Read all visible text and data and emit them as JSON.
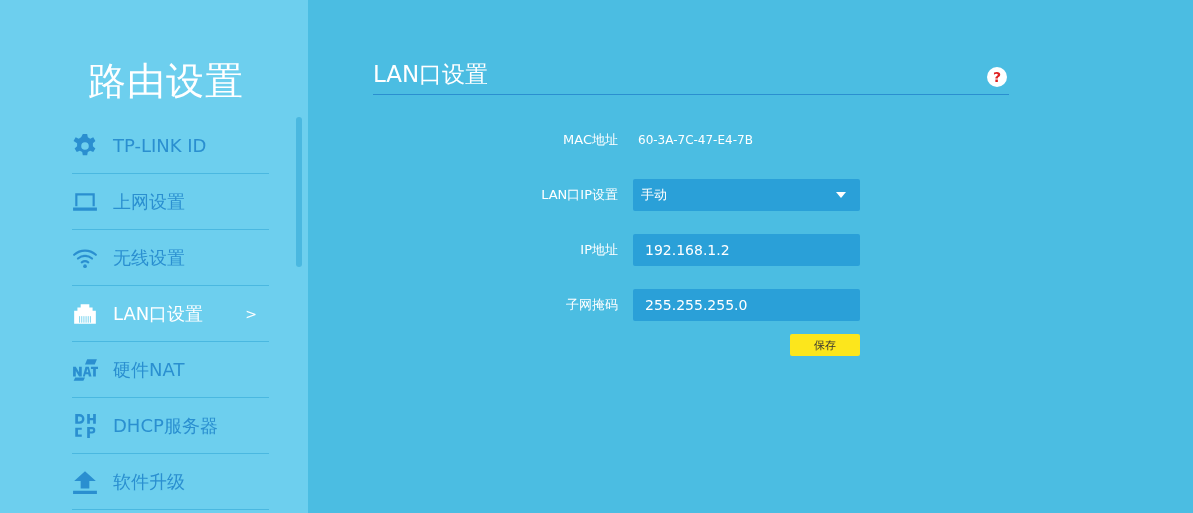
{
  "sidebar": {
    "title": "路由设置",
    "items": [
      {
        "label": "TP-LINK ID",
        "kind": "gear",
        "selected": false
      },
      {
        "label": "上网设置",
        "kind": "laptop",
        "selected": false
      },
      {
        "label": "无线设置",
        "kind": "wifi",
        "selected": false
      },
      {
        "label": "LAN口设置",
        "kind": "port",
        "selected": true,
        "chevron": ">"
      },
      {
        "label": "硬件NAT",
        "kind": "nat",
        "selected": false
      },
      {
        "label": "DHCP服务器",
        "kind": "dhcp",
        "selected": false
      },
      {
        "label": "软件升级",
        "kind": "upload",
        "selected": false
      }
    ]
  },
  "panel": {
    "title": "LAN口设置",
    "help": "?",
    "fields": [
      {
        "label": "MAC地址",
        "kind": "text",
        "value": "60-3A-7C-47-E4-7B"
      },
      {
        "label": "LAN口IP设置",
        "kind": "select",
        "value": "手动"
      },
      {
        "label": "IP地址",
        "kind": "input",
        "value": "192.168.1.2"
      },
      {
        "label": "子网掩码",
        "kind": "input",
        "value": "255.255.255.0"
      }
    ],
    "save_button": "保存"
  }
}
